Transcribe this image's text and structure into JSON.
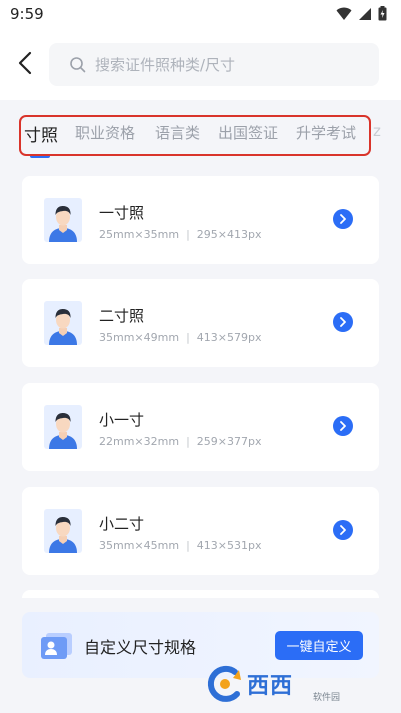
{
  "status_bar": {
    "time": "9:59"
  },
  "search": {
    "placeholder": "搜索证件照种类/尺寸"
  },
  "tabs": [
    {
      "label": "寸照",
      "active": true
    },
    {
      "label": "职业资格"
    },
    {
      "label": "语言类"
    },
    {
      "label": "出国签证"
    },
    {
      "label": "升学考试"
    }
  ],
  "tabs_more": "z",
  "sizes": [
    {
      "title": "一寸照",
      "mm": "25mm×35mm",
      "px": "295×413px"
    },
    {
      "title": "二寸照",
      "mm": "35mm×49mm",
      "px": "413×579px"
    },
    {
      "title": "小一寸",
      "mm": "22mm×32mm",
      "px": "259×377px"
    },
    {
      "title": "小二寸",
      "mm": "35mm×45mm",
      "px": "413×531px"
    }
  ],
  "separator": "|",
  "custom": {
    "title": "自定义尺寸规格",
    "button": "一键自定义"
  },
  "watermark": {
    "text": "西西",
    "sub": "软件园"
  },
  "colors": {
    "accent": "#2b6df6",
    "highlight": "#d9342b",
    "background": "#f4f5f9"
  }
}
